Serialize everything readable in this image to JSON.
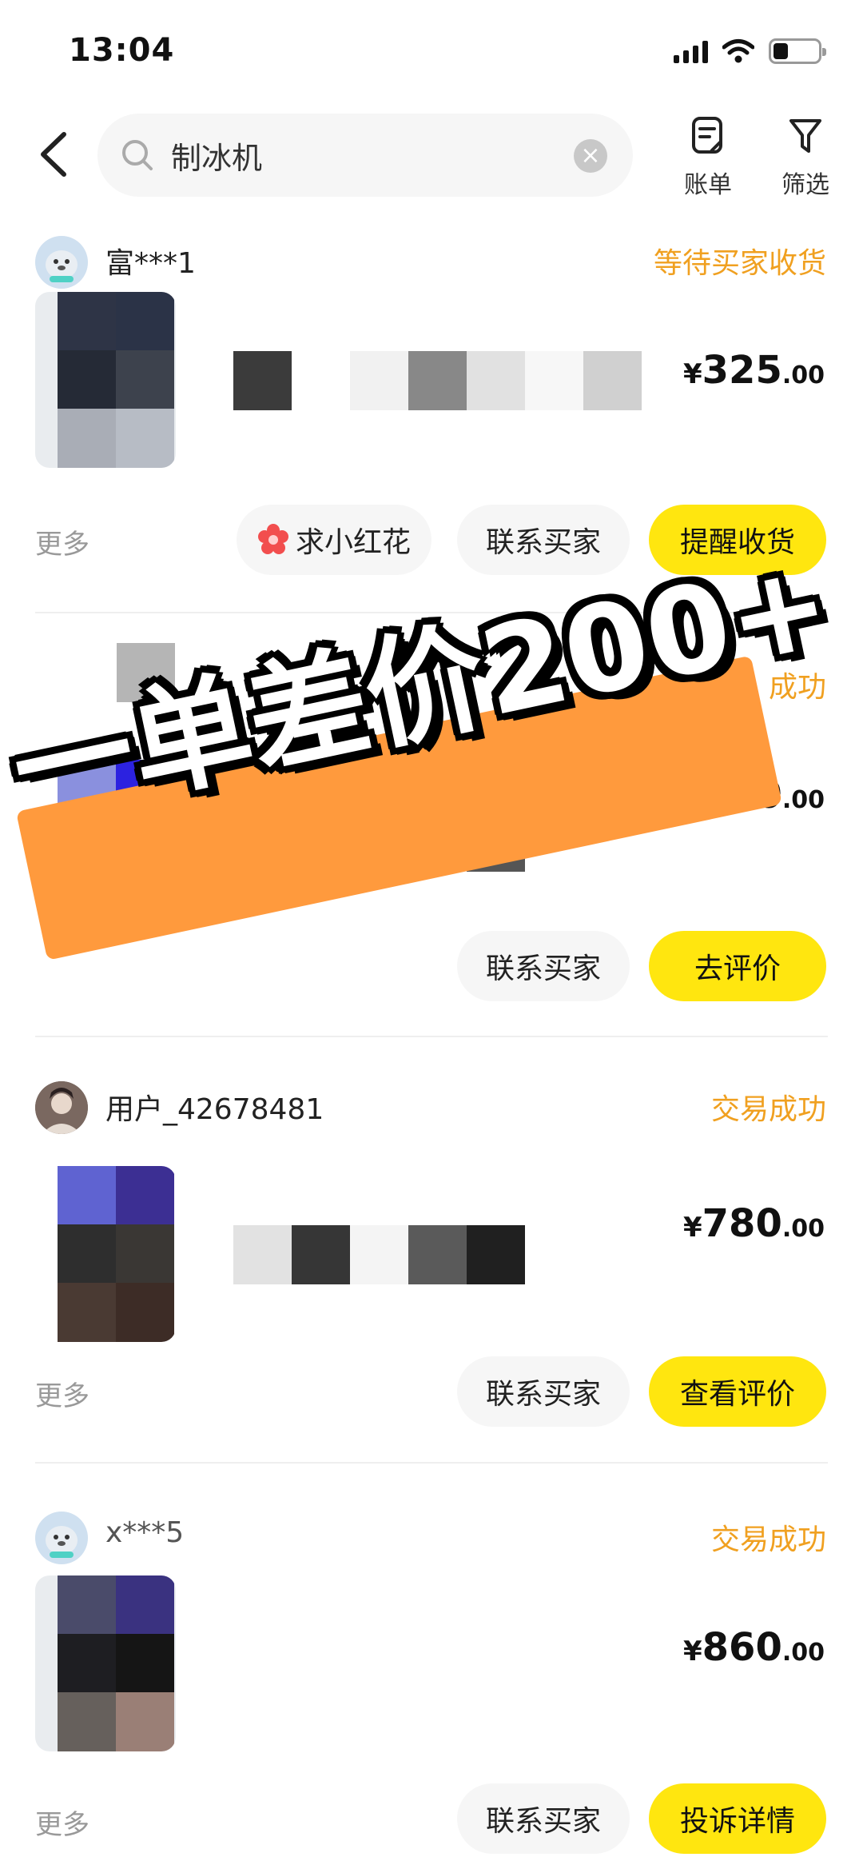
{
  "status_bar": {
    "time": "13:04"
  },
  "search": {
    "query": "制冰机"
  },
  "header_actions": {
    "bill_label": "账单",
    "filter_label": "筛选"
  },
  "banner": {
    "text": "一单差价200+"
  },
  "orders": [
    {
      "seller": "富***1",
      "status": "等待买家收货",
      "price_int": "325",
      "price_dec": ".00",
      "more": "更多",
      "flower_label": "求小红花",
      "contact_label": "联系买家",
      "primary_label": "提醒收货"
    },
    {
      "status": "成功",
      "price_int": "860",
      "price_dec": ".00",
      "contact_label": "联系买家",
      "primary_label": "去评价"
    },
    {
      "seller": "用户_42678481",
      "status": "交易成功",
      "price_int": "780",
      "price_dec": ".00",
      "more": "更多",
      "contact_label": "联系买家",
      "primary_label": "查看评价"
    },
    {
      "seller": "x***5",
      "status": "交易成功",
      "price_int": "860",
      "price_dec": ".00",
      "more": "更多",
      "contact_label": "联系买家",
      "primary_label": "投诉详情"
    }
  ],
  "currency": "¥",
  "colors": {
    "accent_yellow": "#ffe60f",
    "status_orange": "#f0a020",
    "banner_orange": "#ff9a3d"
  }
}
